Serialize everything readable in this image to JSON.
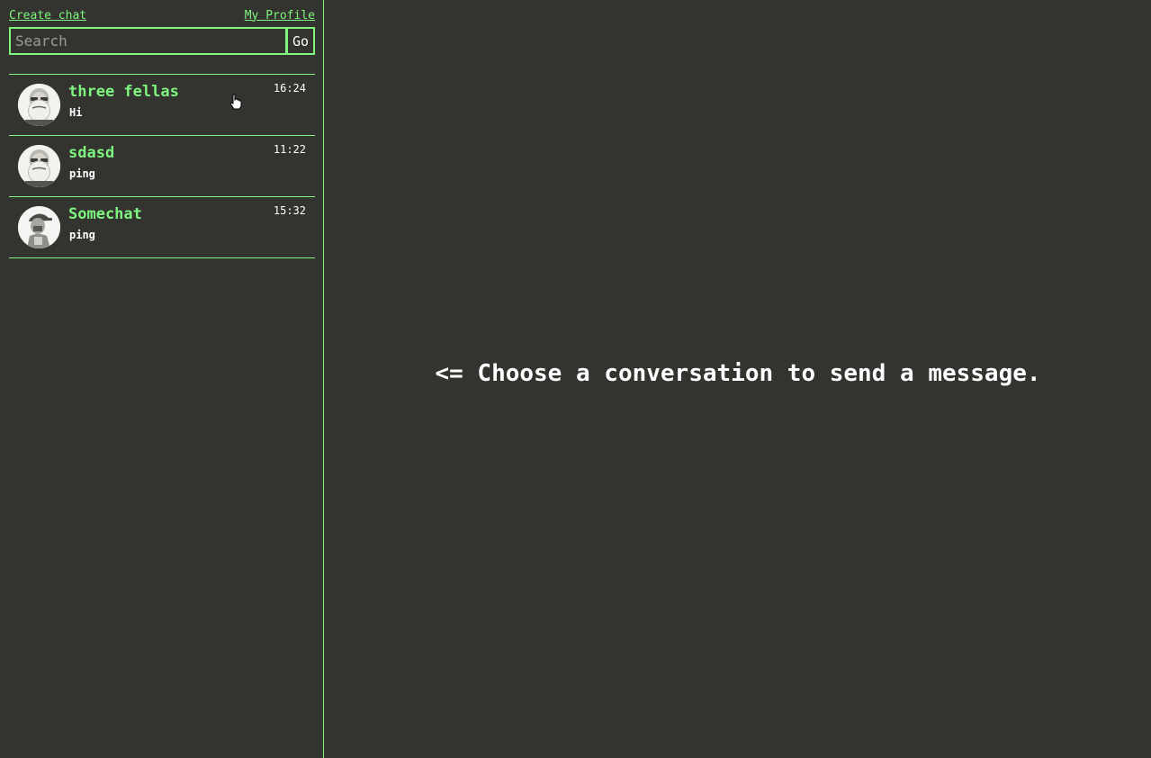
{
  "header": {
    "create_chat_label": "Create chat",
    "profile_label": "My Profile"
  },
  "search": {
    "placeholder": "Search",
    "value": "",
    "go_label": "Go"
  },
  "chats": [
    {
      "name": "three fellas",
      "preview": "Hi",
      "time": "16:24",
      "avatar_icon": "bearded-man-avatar"
    },
    {
      "name": "sdasd",
      "preview": "ping",
      "time": "11:22",
      "avatar_icon": "bearded-man-avatar"
    },
    {
      "name": "Somechat",
      "preview": "ping",
      "time": "15:32",
      "avatar_icon": "man-with-cap-avatar"
    }
  ],
  "main": {
    "empty_message": "<= Choose a conversation to send a message."
  },
  "colors": {
    "background": "#33332f",
    "accent": "#7ef57e",
    "text": "#ffffff"
  }
}
